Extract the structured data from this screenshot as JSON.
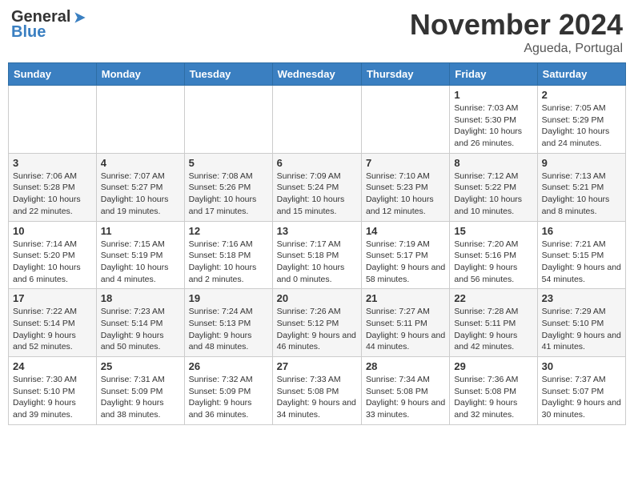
{
  "header": {
    "logo_general": "General",
    "logo_blue": "Blue",
    "month_title": "November 2024",
    "location": "Agueda, Portugal"
  },
  "weekdays": [
    "Sunday",
    "Monday",
    "Tuesday",
    "Wednesday",
    "Thursday",
    "Friday",
    "Saturday"
  ],
  "weeks": [
    [
      {
        "day": "",
        "info": ""
      },
      {
        "day": "",
        "info": ""
      },
      {
        "day": "",
        "info": ""
      },
      {
        "day": "",
        "info": ""
      },
      {
        "day": "",
        "info": ""
      },
      {
        "day": "1",
        "info": "Sunrise: 7:03 AM\nSunset: 5:30 PM\nDaylight: 10 hours and 26 minutes."
      },
      {
        "day": "2",
        "info": "Sunrise: 7:05 AM\nSunset: 5:29 PM\nDaylight: 10 hours and 24 minutes."
      }
    ],
    [
      {
        "day": "3",
        "info": "Sunrise: 7:06 AM\nSunset: 5:28 PM\nDaylight: 10 hours and 22 minutes."
      },
      {
        "day": "4",
        "info": "Sunrise: 7:07 AM\nSunset: 5:27 PM\nDaylight: 10 hours and 19 minutes."
      },
      {
        "day": "5",
        "info": "Sunrise: 7:08 AM\nSunset: 5:26 PM\nDaylight: 10 hours and 17 minutes."
      },
      {
        "day": "6",
        "info": "Sunrise: 7:09 AM\nSunset: 5:24 PM\nDaylight: 10 hours and 15 minutes."
      },
      {
        "day": "7",
        "info": "Sunrise: 7:10 AM\nSunset: 5:23 PM\nDaylight: 10 hours and 12 minutes."
      },
      {
        "day": "8",
        "info": "Sunrise: 7:12 AM\nSunset: 5:22 PM\nDaylight: 10 hours and 10 minutes."
      },
      {
        "day": "9",
        "info": "Sunrise: 7:13 AM\nSunset: 5:21 PM\nDaylight: 10 hours and 8 minutes."
      }
    ],
    [
      {
        "day": "10",
        "info": "Sunrise: 7:14 AM\nSunset: 5:20 PM\nDaylight: 10 hours and 6 minutes."
      },
      {
        "day": "11",
        "info": "Sunrise: 7:15 AM\nSunset: 5:19 PM\nDaylight: 10 hours and 4 minutes."
      },
      {
        "day": "12",
        "info": "Sunrise: 7:16 AM\nSunset: 5:18 PM\nDaylight: 10 hours and 2 minutes."
      },
      {
        "day": "13",
        "info": "Sunrise: 7:17 AM\nSunset: 5:18 PM\nDaylight: 10 hours and 0 minutes."
      },
      {
        "day": "14",
        "info": "Sunrise: 7:19 AM\nSunset: 5:17 PM\nDaylight: 9 hours and 58 minutes."
      },
      {
        "day": "15",
        "info": "Sunrise: 7:20 AM\nSunset: 5:16 PM\nDaylight: 9 hours and 56 minutes."
      },
      {
        "day": "16",
        "info": "Sunrise: 7:21 AM\nSunset: 5:15 PM\nDaylight: 9 hours and 54 minutes."
      }
    ],
    [
      {
        "day": "17",
        "info": "Sunrise: 7:22 AM\nSunset: 5:14 PM\nDaylight: 9 hours and 52 minutes."
      },
      {
        "day": "18",
        "info": "Sunrise: 7:23 AM\nSunset: 5:14 PM\nDaylight: 9 hours and 50 minutes."
      },
      {
        "day": "19",
        "info": "Sunrise: 7:24 AM\nSunset: 5:13 PM\nDaylight: 9 hours and 48 minutes."
      },
      {
        "day": "20",
        "info": "Sunrise: 7:26 AM\nSunset: 5:12 PM\nDaylight: 9 hours and 46 minutes."
      },
      {
        "day": "21",
        "info": "Sunrise: 7:27 AM\nSunset: 5:11 PM\nDaylight: 9 hours and 44 minutes."
      },
      {
        "day": "22",
        "info": "Sunrise: 7:28 AM\nSunset: 5:11 PM\nDaylight: 9 hours and 42 minutes."
      },
      {
        "day": "23",
        "info": "Sunrise: 7:29 AM\nSunset: 5:10 PM\nDaylight: 9 hours and 41 minutes."
      }
    ],
    [
      {
        "day": "24",
        "info": "Sunrise: 7:30 AM\nSunset: 5:10 PM\nDaylight: 9 hours and 39 minutes."
      },
      {
        "day": "25",
        "info": "Sunrise: 7:31 AM\nSunset: 5:09 PM\nDaylight: 9 hours and 38 minutes."
      },
      {
        "day": "26",
        "info": "Sunrise: 7:32 AM\nSunset: 5:09 PM\nDaylight: 9 hours and 36 minutes."
      },
      {
        "day": "27",
        "info": "Sunrise: 7:33 AM\nSunset: 5:08 PM\nDaylight: 9 hours and 34 minutes."
      },
      {
        "day": "28",
        "info": "Sunrise: 7:34 AM\nSunset: 5:08 PM\nDaylight: 9 hours and 33 minutes."
      },
      {
        "day": "29",
        "info": "Sunrise: 7:36 AM\nSunset: 5:08 PM\nDaylight: 9 hours and 32 minutes."
      },
      {
        "day": "30",
        "info": "Sunrise: 7:37 AM\nSunset: 5:07 PM\nDaylight: 9 hours and 30 minutes."
      }
    ]
  ]
}
